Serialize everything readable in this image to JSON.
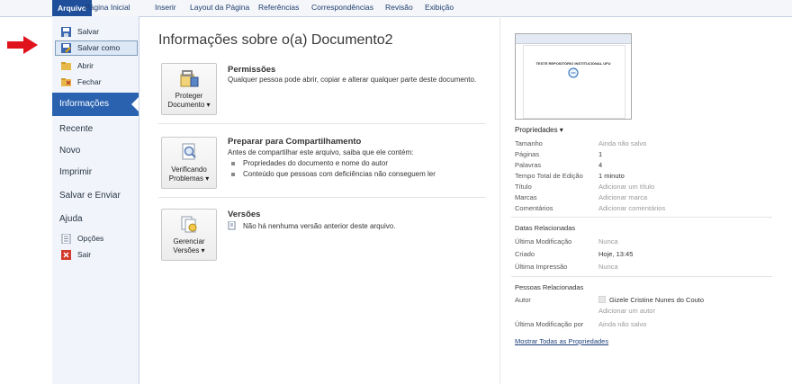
{
  "tabs": [
    "Arquivo",
    "Página Inicial",
    "Inserir",
    "Layout da Página",
    "Referências",
    "Correspondências",
    "Revisão",
    "Exibição"
  ],
  "nav": {
    "save": "Salvar",
    "save_as": "Salvar como",
    "open": "Abrir",
    "close": "Fechar",
    "info": "Informações",
    "recent": "Recente",
    "new": "Novo",
    "print": "Imprimir",
    "save_send": "Salvar e Enviar",
    "help": "Ajuda",
    "options": "Opções",
    "exit": "Sair"
  },
  "main": {
    "title": "Informações sobre o(a) Documento2",
    "permissions": {
      "button_line1": "Proteger",
      "button_line2": "Documento ▾",
      "title": "Permissões",
      "text": "Qualquer pessoa pode abrir, copiar e alterar qualquer parte deste documento."
    },
    "prepare": {
      "button_line1": "Verificando",
      "button_line2": "Problemas ▾",
      "title": "Preparar para Compartilhamento",
      "text": "Antes de compartilhar este arquivo, saiba que ele contém:",
      "bullets": [
        "Propriedades do documento e nome do autor",
        "Conteúdo que pessoas com deficiências não conseguem ler"
      ]
    },
    "versions": {
      "button_line1": "Gerenciar",
      "button_line2": "Versões ▾",
      "title": "Versões",
      "text": "Não há nenhuma versão anterior deste arquivo."
    }
  },
  "preview": {
    "doc_text": "TESTE REPOSITÓRIO INSTITUCIONAL UFU"
  },
  "properties": {
    "header": "Propriedades ▾",
    "rows": [
      {
        "label": "Tamanho",
        "value": "Ainda não salvo"
      },
      {
        "label": "Páginas",
        "value": "1"
      },
      {
        "label": "Palavras",
        "value": "4"
      },
      {
        "label": "Tempo Total de Edição",
        "value": "1 minuto"
      },
      {
        "label": "Título",
        "value": "Adicionar um título"
      },
      {
        "label": "Marcas",
        "value": "Adicionar marca"
      },
      {
        "label": "Comentários",
        "value": "Adicionar comentários"
      }
    ],
    "dates_header": "Datas Relacionadas",
    "dates": [
      {
        "label": "Última Modificação",
        "value": "Nunca"
      },
      {
        "label": "Criado",
        "value": "Hoje, 13:45"
      },
      {
        "label": "Última Impressão",
        "value": "Nunca"
      }
    ],
    "people_header": "Pessoas Relacionadas",
    "author_label": "Autor",
    "author_name": "Gizele Cristine Nunes do Couto",
    "add_author": "Adicionar um autor",
    "last_modified_by_label": "Última Modificação por",
    "last_modified_by_value": "Ainda não salvo",
    "show_all": "Mostrar Todas as Propriedades"
  },
  "colors": {
    "file_tab": "#1f4f9a",
    "nav_selected": "#2a62b0",
    "annotation_arrow": "#e0121b"
  }
}
